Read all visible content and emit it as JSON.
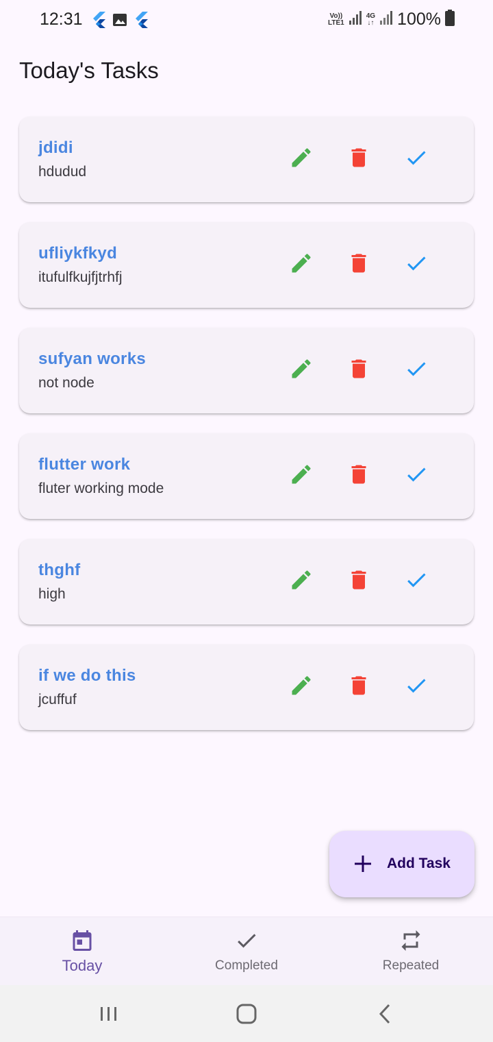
{
  "status_bar": {
    "time": "12:31",
    "network_label_top": "Vo))",
    "network_label_bottom": "LTE1",
    "network_4g": "4G",
    "battery": "100%",
    "icons": [
      "flutter-icon",
      "image-icon",
      "flutter-icon",
      "signal-icon",
      "signal-icon",
      "battery-icon"
    ]
  },
  "page": {
    "title": "Today's Tasks"
  },
  "tasks": [
    {
      "title": "jdidi",
      "description": "hdudud"
    },
    {
      "title": "ufliykfkyd",
      "description": "itufulfkujfjtrhfj"
    },
    {
      "title": "sufyan works",
      "description": "not node"
    },
    {
      "title": "flutter work",
      "description": "fluter working mode"
    },
    {
      "title": "thghf",
      "description": "high"
    },
    {
      "title": "if we do this",
      "description": "jcuffuf"
    }
  ],
  "task_actions": {
    "icons": [
      "pencil-icon",
      "trash-icon",
      "check-icon"
    ],
    "colors": {
      "edit": "#4caf50",
      "delete": "#f44336",
      "complete": "#2196f3"
    }
  },
  "fab": {
    "label": "Add Task",
    "icon": "plus-icon"
  },
  "bottom_nav": {
    "items": [
      {
        "label": "Today",
        "icon": "calendar-icon",
        "active": true
      },
      {
        "label": "Completed",
        "icon": "check-icon",
        "active": false
      },
      {
        "label": "Repeated",
        "icon": "repeat-icon",
        "active": false
      }
    ]
  },
  "system_nav": {
    "icons": [
      "recents-icon",
      "home-icon",
      "back-icon"
    ]
  },
  "colors": {
    "background": "#fdf7ff",
    "card": "#f6f1f8",
    "task_title": "#4a86e0",
    "fab": "#eaddff",
    "accent": "#6750a4"
  }
}
